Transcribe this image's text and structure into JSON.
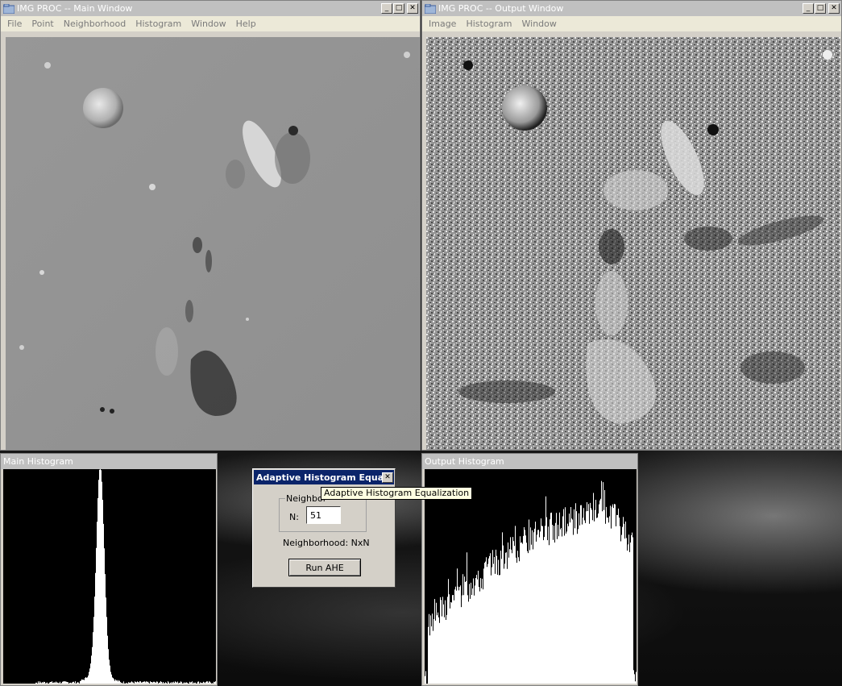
{
  "main_window": {
    "title": "IMG PROC -- Main Window",
    "menu": [
      "File",
      "Point",
      "Neighborhood",
      "Histogram",
      "Window",
      "Help"
    ]
  },
  "output_window": {
    "title": "IMG PROC -- Output Window",
    "menu": [
      "Image",
      "Histogram",
      "Window"
    ]
  },
  "main_histogram": {
    "title": "Main Histogram"
  },
  "output_histogram": {
    "title": "Output Histogram"
  },
  "dialog": {
    "title": "Adaptive Histogram Equali...",
    "group_label": "Neighbor",
    "n_label": "N:",
    "n_value": "51",
    "neighborhood_text": "Neighborhood: NxN",
    "run_label": "Run AHE"
  },
  "tooltip": {
    "text": "Adaptive Histogram Equalization"
  },
  "caption_glyphs": {
    "minimize": "_",
    "maximize": "□",
    "close": "✕"
  }
}
